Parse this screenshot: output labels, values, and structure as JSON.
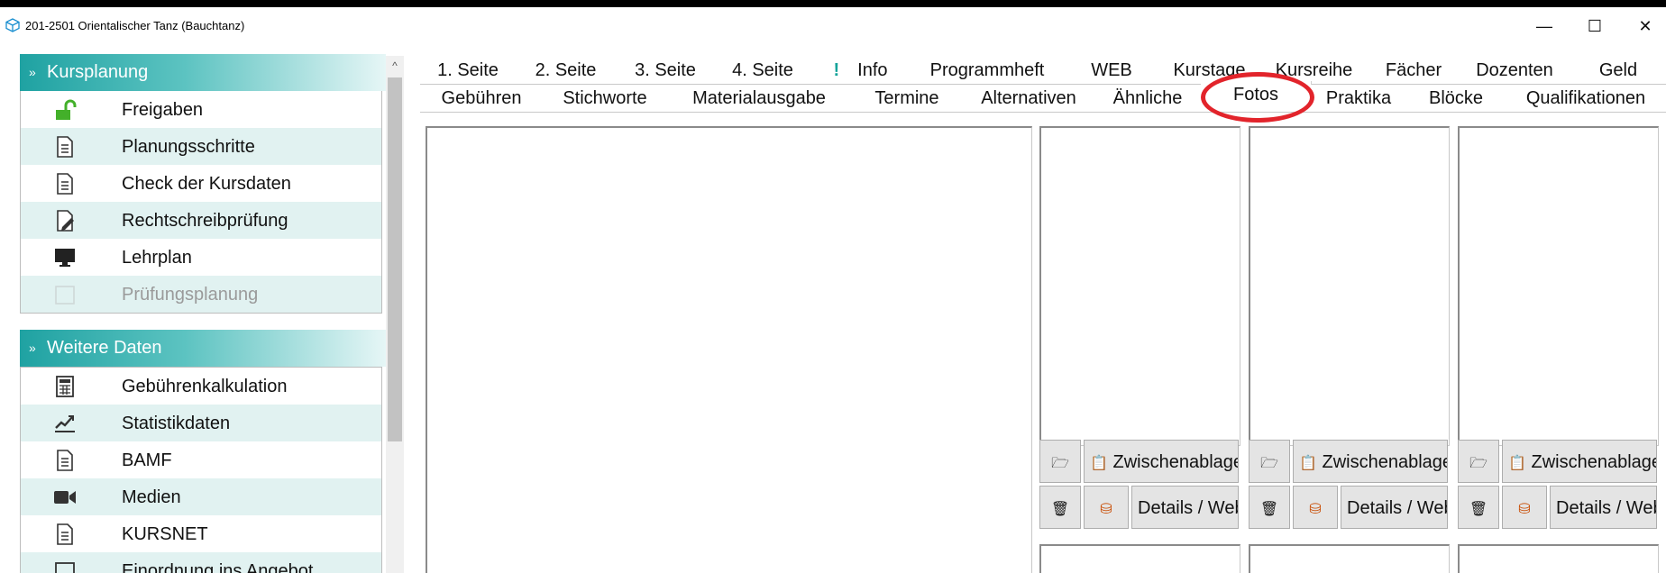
{
  "window": {
    "title": "201-2501 Orientalischer Tanz (Bauchtanz)",
    "controls": {
      "minimize": "—",
      "maximize": "☐",
      "close": "✕"
    }
  },
  "sidebar": {
    "groups": [
      {
        "label": "Kursplanung",
        "items": [
          {
            "label": "Freigaben",
            "icon": "unlock-icon"
          },
          {
            "label": "Planungsschritte",
            "icon": "document-icon"
          },
          {
            "label": "Check der Kursdaten",
            "icon": "document-icon"
          },
          {
            "label": "Rechtschreibprüfung",
            "icon": "edit-document-icon"
          },
          {
            "label": "Lehrplan",
            "icon": "monitor-icon"
          },
          {
            "label": "Prüfungsplanung",
            "icon": "calendar-icon",
            "disabled": true
          }
        ]
      },
      {
        "label": "Weitere Daten",
        "items": [
          {
            "label": "Gebührenkalkulation",
            "icon": "calculator-icon"
          },
          {
            "label": "Statistikdaten",
            "icon": "chart-line-icon"
          },
          {
            "label": "BAMF",
            "icon": "document-icon"
          },
          {
            "label": "Medien",
            "icon": "video-camera-icon"
          },
          {
            "label": "KURSNET",
            "icon": "document-icon"
          },
          {
            "label": "Einordnung ins Angebot",
            "icon": "tag-icon"
          }
        ]
      }
    ]
  },
  "tabs": {
    "row1": [
      "1. Seite",
      "2. Seite",
      "3. Seite",
      "4. Seite",
      "Info",
      "Programmheft",
      "WEB",
      "Kurstage",
      "Kursreihe",
      "Fächer",
      "Dozenten",
      "Geld"
    ],
    "row2": [
      "Gebühren",
      "Stichworte",
      "Materialausgabe",
      "Termine",
      "Alternativen",
      "Ähnliche",
      "Fotos",
      "Praktika",
      "Blöcke",
      "Qualifikationen"
    ],
    "active": "Fotos",
    "info_marker": "!"
  },
  "photo_buttons": {
    "clipboard": "Zwischenablage",
    "details": "Details / Web"
  },
  "colors": {
    "accent": "#1fa2a2",
    "row_alt": "#e1f2f1",
    "highlight": "#e2242b"
  }
}
